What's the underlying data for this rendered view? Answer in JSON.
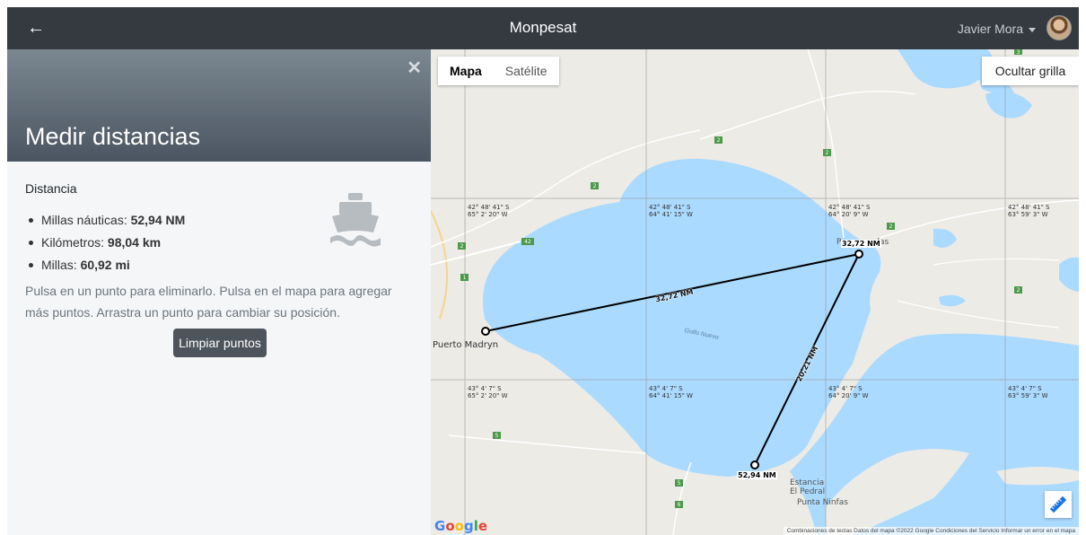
{
  "header": {
    "title": "Monpesat",
    "user_name": "Javier Mora"
  },
  "panel": {
    "title": "Medir distancias",
    "distance_heading": "Distancia",
    "metrics": [
      {
        "label": "Millas náuticas: ",
        "value": "52,94 NM"
      },
      {
        "label": "Kilómetros: ",
        "value": "98,04 km"
      },
      {
        "label": "Millas: ",
        "value": "60,92 mi"
      }
    ],
    "instructions": "Pulsa en un punto para eliminarlo. Pulsa en el mapa para agregar más puntos. Arrastra un punto para cambiar su posición.",
    "clear_button": "Limpiar puntos"
  },
  "map": {
    "map_types": {
      "map": "Mapa",
      "satellite": "Satélite"
    },
    "grid_button": "Ocultar grilla",
    "grid_labels": [
      {
        "lat": "42° 48' 41\" S",
        "lon": "65° 2' 20\" W"
      },
      {
        "lat": "42° 48' 41\" S",
        "lon": "64° 41' 15\" W"
      },
      {
        "lat": "42° 48' 41\" S",
        "lon": "64° 20' 9\" W"
      },
      {
        "lat": "42° 48' 41\" S",
        "lon": "63° 59' 3\" W"
      },
      {
        "lat": "43° 4' 7\" S",
        "lon": "65° 2' 20\" W"
      },
      {
        "lat": "43° 4' 7\" S",
        "lon": "64° 41' 15\" W"
      },
      {
        "lat": "43° 4' 7\" S",
        "lon": "64° 20' 9\" W"
      },
      {
        "lat": "43° 4' 7\" S",
        "lon": "63° 59' 3\" W"
      }
    ],
    "places": {
      "city": "Puerto Madryn",
      "gulf": "Golfo Nuevo",
      "estancia_1": "Estancia",
      "estancia_2": "El Pedral",
      "punta": "Punta Ninfas",
      "piramides_prefix": "P",
      "piramides_suffix": "elas"
    },
    "road_numbers": [
      "2",
      "2",
      "42",
      "2",
      "2",
      "2",
      "1",
      "2",
      "5",
      "5",
      "6",
      "3"
    ],
    "segment_labels": {
      "seg1": "32,72 NM",
      "seg2": "20,21 NM"
    },
    "point_labels": {
      "p2": "32,72 NM",
      "p3": "52,94 NM"
    },
    "google": "Google",
    "attribution": "Combinaciones de teclas   Datos del mapa ©2022 Google   Condiciones del Servicio   Informar un error en el mapa"
  },
  "colors": {
    "topbar": "#343a40",
    "water": "#aadaff",
    "land": "#ecebe6",
    "button_dark": "#4d545b"
  }
}
